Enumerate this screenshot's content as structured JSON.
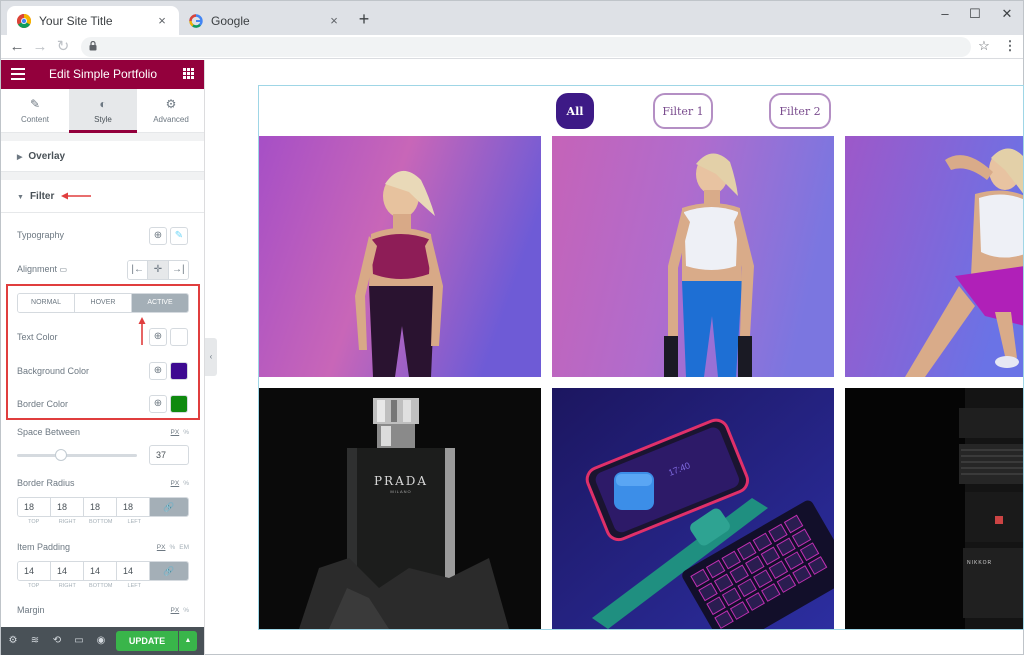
{
  "browser": {
    "tabs": [
      {
        "title": "Your Site Title",
        "active": true
      },
      {
        "title": "Google",
        "active": false
      }
    ],
    "new_tab_symbol": "+",
    "close_symbol": "×",
    "window_controls": [
      "minimize-icon",
      "maximize-icon",
      "close-icon"
    ]
  },
  "editor": {
    "title": "Edit Simple Portfolio",
    "tabs": [
      {
        "label": "Content",
        "icon": "pencil-icon",
        "selected": false
      },
      {
        "label": "Style",
        "icon": "contrast-icon",
        "selected": true
      },
      {
        "label": "Advanced",
        "icon": "gear-icon",
        "selected": false
      }
    ],
    "sections": {
      "overlay": "Overlay",
      "filter": "Filter"
    },
    "controls": {
      "typography": "Typography",
      "alignment": "Alignment",
      "state_tabs": [
        "NORMAL",
        "HOVER",
        "ACTIVE"
      ],
      "active_state": "ACTIVE",
      "text_color": "Text Color",
      "background_color": "Background Color",
      "background_color_value": "#3d0a91",
      "border_color": "Border Color",
      "border_color_value": "#0f8a0f",
      "space_between": "Space Between",
      "space_between_value": "37",
      "space_between_slider": 0.37,
      "border_radius": "Border Radius",
      "border_radius_values": [
        "18",
        "18",
        "18",
        "18"
      ],
      "item_padding": "Item Padding",
      "item_padding_values": [
        "14",
        "14",
        "14",
        "14"
      ],
      "dim_labels": [
        "TOP",
        "RIGHT",
        "BOTTOM",
        "LEFT"
      ],
      "margin": "Margin",
      "units_px": "PX",
      "units_pct": "%",
      "units_em": "EM"
    },
    "footer": {
      "update_label": "UPDATE"
    }
  },
  "canvas": {
    "filters": [
      "All",
      "Filter 1",
      "Filter 2"
    ],
    "active_filter": "All",
    "tiles": [
      {
        "label": "woman-pink-sports-top-photo"
      },
      {
        "label": "woman-white-top-blue-leggings-photo"
      },
      {
        "label": "woman-stretching-photo"
      },
      {
        "label": "prada-perfume-bottle-photo",
        "brand_text": "PRADA",
        "sub_text": "MILANO"
      },
      {
        "label": "phone-keyboard-watch-photo",
        "phone_time": "17:40"
      },
      {
        "label": "camera-lens-photo",
        "lens_text": "NIKKOR"
      }
    ]
  },
  "colors": {
    "brand": "#93003c",
    "accent": "#3d1a86",
    "update": "#39b54a",
    "annotation": "#e03e3e"
  }
}
